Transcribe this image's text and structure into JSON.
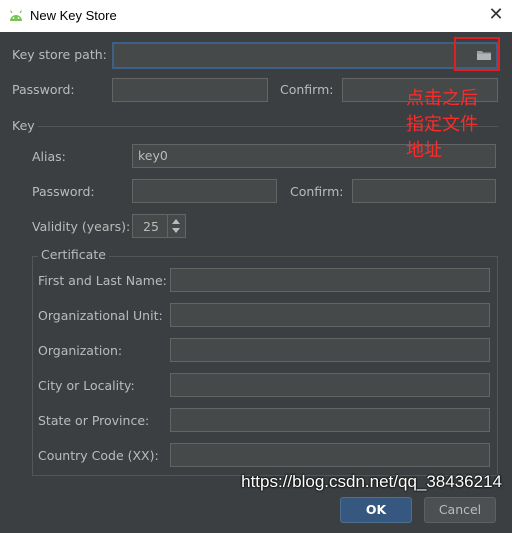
{
  "window": {
    "title": "New Key Store",
    "close_glyph": "✕",
    "app_icon": "android-icon"
  },
  "keystore": {
    "path_label": "Key store path:",
    "path_value": "",
    "browse_icon": "folder-icon",
    "password_label": "Password:",
    "confirm_label": "Confirm:"
  },
  "key": {
    "section_label": "Key",
    "alias_label": "Alias:",
    "alias_value": "key0",
    "password_label": "Password:",
    "confirm_label": "Confirm:",
    "validity_label": "Validity (years):",
    "validity_value": "25"
  },
  "certificate": {
    "group_label": "Certificate",
    "fields": [
      {
        "label": "First and Last Name:",
        "value": ""
      },
      {
        "label": "Organizational Unit:",
        "value": ""
      },
      {
        "label": "Organization:",
        "value": ""
      },
      {
        "label": "City or Locality:",
        "value": ""
      },
      {
        "label": "State or Province:",
        "value": ""
      },
      {
        "label": "Country Code (XX):",
        "value": ""
      }
    ]
  },
  "buttons": {
    "ok": "OK",
    "cancel": "Cancel"
  },
  "annotation": {
    "line1": "点击之后",
    "line2": "指定文件",
    "line3": "地址",
    "color": "#ff2a2a"
  },
  "watermark": "https://blog.csdn.net/qq_38436214",
  "colors": {
    "background": "#3c3f41",
    "field": "#45494a",
    "focus_border": "#3d6185",
    "ok_button": "#365880"
  }
}
